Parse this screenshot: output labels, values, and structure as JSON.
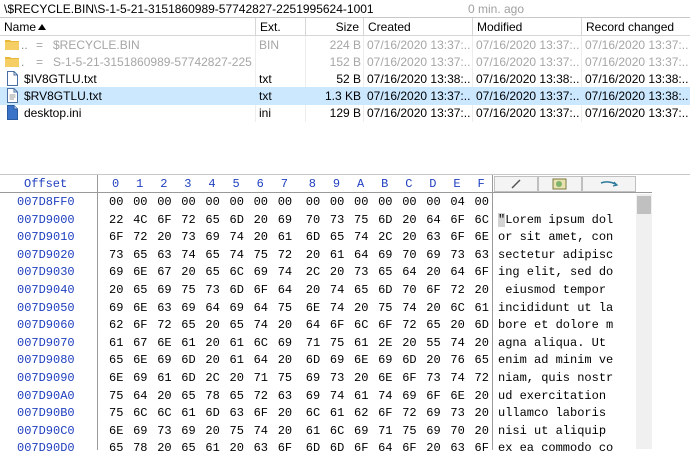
{
  "pathbar": {
    "path": "\\$RECYCLE.BIN\\S-1-5-21-3151860989-57742827-2251995624-1001",
    "age": "0 min. ago"
  },
  "filelist": {
    "columns": {
      "name": "Name",
      "ext": "Ext.",
      "size": "Size",
      "created": "Created",
      "modified": "Modified",
      "record_changed": "Record changed"
    },
    "rows": [
      {
        "icon": "folder-icon",
        "prefix": "..",
        "name": "$RECYCLE.BIN",
        "ext": "BIN",
        "size": "224 B",
        "created": "07/16/2020  13:37:...",
        "modified": "07/16/2020  13:37:...",
        "record_changed": "07/16/2020  13:37:..."
      },
      {
        "icon": "folder-icon",
        "prefix": ".",
        "name": "S-1-5-21-3151860989-57742827-2251...",
        "ext": "",
        "size": "152 B",
        "created": "07/16/2020  13:37:...",
        "modified": "07/16/2020  13:37:...",
        "record_changed": "07/16/2020  13:37:..."
      },
      {
        "icon": "text-file-icon",
        "prefix": "",
        "name": "$IV8GTLU.txt",
        "ext": "txt",
        "size": "52 B",
        "created": "07/16/2020  13:38:...",
        "modified": "07/16/2020  13:38:...",
        "record_changed": "07/16/2020  13:38:..."
      },
      {
        "icon": "text-file-icon",
        "prefix": "",
        "name": "$RV8GTLU.txt",
        "ext": "txt",
        "size": "1.3 KB",
        "created": "07/16/2020  13:37:...",
        "modified": "07/16/2020  13:37:...",
        "record_changed": "07/16/2020  13:38:..."
      },
      {
        "icon": "ini-file-icon",
        "prefix": "",
        "name": "desktop.ini",
        "ext": "ini",
        "size": "129 B",
        "created": "07/16/2020  13:37:...",
        "modified": "07/16/2020  13:37:...",
        "record_changed": "07/16/2020  13:37:..."
      }
    ]
  },
  "hexview": {
    "header_offset": "Offset",
    "header_cols": [
      "0",
      "1",
      "2",
      "3",
      "4",
      "5",
      "6",
      "7",
      "8",
      "9",
      "A",
      "B",
      "C",
      "D",
      "E",
      "F"
    ],
    "rows": [
      {
        "offset": "007D8FF0",
        "bytes": [
          "00",
          "00",
          "00",
          "00",
          "00",
          "00",
          "00",
          "00",
          "00",
          "00",
          "00",
          "00",
          "00",
          "00",
          "04",
          "00"
        ],
        "text": ""
      },
      {
        "offset": "007D9000",
        "bytes": [
          "22",
          "4C",
          "6F",
          "72",
          "65",
          "6D",
          "20",
          "69",
          "70",
          "73",
          "75",
          "6D",
          "20",
          "64",
          "6F",
          "6C"
        ],
        "text": "\"Lorem ipsum dol"
      },
      {
        "offset": "007D9010",
        "bytes": [
          "6F",
          "72",
          "20",
          "73",
          "69",
          "74",
          "20",
          "61",
          "6D",
          "65",
          "74",
          "2C",
          "20",
          "63",
          "6F",
          "6E"
        ],
        "text": "or sit amet, con"
      },
      {
        "offset": "007D9020",
        "bytes": [
          "73",
          "65",
          "63",
          "74",
          "65",
          "74",
          "75",
          "72",
          "20",
          "61",
          "64",
          "69",
          "70",
          "69",
          "73",
          "63"
        ],
        "text": "sectetur adipisc"
      },
      {
        "offset": "007D9030",
        "bytes": [
          "69",
          "6E",
          "67",
          "20",
          "65",
          "6C",
          "69",
          "74",
          "2C",
          "20",
          "73",
          "65",
          "64",
          "20",
          "64",
          "6F"
        ],
        "text": "ing elit, sed do"
      },
      {
        "offset": "007D9040",
        "bytes": [
          "20",
          "65",
          "69",
          "75",
          "73",
          "6D",
          "6F",
          "64",
          "20",
          "74",
          "65",
          "6D",
          "70",
          "6F",
          "72",
          "20"
        ],
        "text": " eiusmod tempor "
      },
      {
        "offset": "007D9050",
        "bytes": [
          "69",
          "6E",
          "63",
          "69",
          "64",
          "69",
          "64",
          "75",
          "6E",
          "74",
          "20",
          "75",
          "74",
          "20",
          "6C",
          "61"
        ],
        "text": "incididunt ut la"
      },
      {
        "offset": "007D9060",
        "bytes": [
          "62",
          "6F",
          "72",
          "65",
          "20",
          "65",
          "74",
          "20",
          "64",
          "6F",
          "6C",
          "6F",
          "72",
          "65",
          "20",
          "6D"
        ],
        "text": "bore et dolore m"
      },
      {
        "offset": "007D9070",
        "bytes": [
          "61",
          "67",
          "6E",
          "61",
          "20",
          "61",
          "6C",
          "69",
          "71",
          "75",
          "61",
          "2E",
          "20",
          "55",
          "74",
          "20"
        ],
        "text": "agna aliqua. Ut "
      },
      {
        "offset": "007D9080",
        "bytes": [
          "65",
          "6E",
          "69",
          "6D",
          "20",
          "61",
          "64",
          "20",
          "6D",
          "69",
          "6E",
          "69",
          "6D",
          "20",
          "76",
          "65"
        ],
        "text": "enim ad minim ve"
      },
      {
        "offset": "007D9090",
        "bytes": [
          "6E",
          "69",
          "61",
          "6D",
          "2C",
          "20",
          "71",
          "75",
          "69",
          "73",
          "20",
          "6E",
          "6F",
          "73",
          "74",
          "72"
        ],
        "text": "niam, quis nostr"
      },
      {
        "offset": "007D90A0",
        "bytes": [
          "75",
          "64",
          "20",
          "65",
          "78",
          "65",
          "72",
          "63",
          "69",
          "74",
          "61",
          "74",
          "69",
          "6F",
          "6E",
          "20"
        ],
        "text": "ud exercitation "
      },
      {
        "offset": "007D90B0",
        "bytes": [
          "75",
          "6C",
          "6C",
          "61",
          "6D",
          "63",
          "6F",
          "20",
          "6C",
          "61",
          "62",
          "6F",
          "72",
          "69",
          "73",
          "20"
        ],
        "text": "ullamco laboris "
      },
      {
        "offset": "007D90C0",
        "bytes": [
          "6E",
          "69",
          "73",
          "69",
          "20",
          "75",
          "74",
          "20",
          "61",
          "6C",
          "69",
          "71",
          "75",
          "69",
          "70",
          "20"
        ],
        "text": "nisi ut aliquip "
      },
      {
        "offset": "007D90D0",
        "bytes": [
          "65",
          "78",
          "20",
          "65",
          "61",
          "20",
          "63",
          "6F",
          "6D",
          "6D",
          "6F",
          "64",
          "6F",
          "20",
          "63",
          "6F"
        ],
        "text": "ex ea commodo co"
      }
    ]
  },
  "colors": {
    "accent_blue": "#1f3fbf",
    "selection": "#cce8ff",
    "folder": "#e8b83a"
  }
}
